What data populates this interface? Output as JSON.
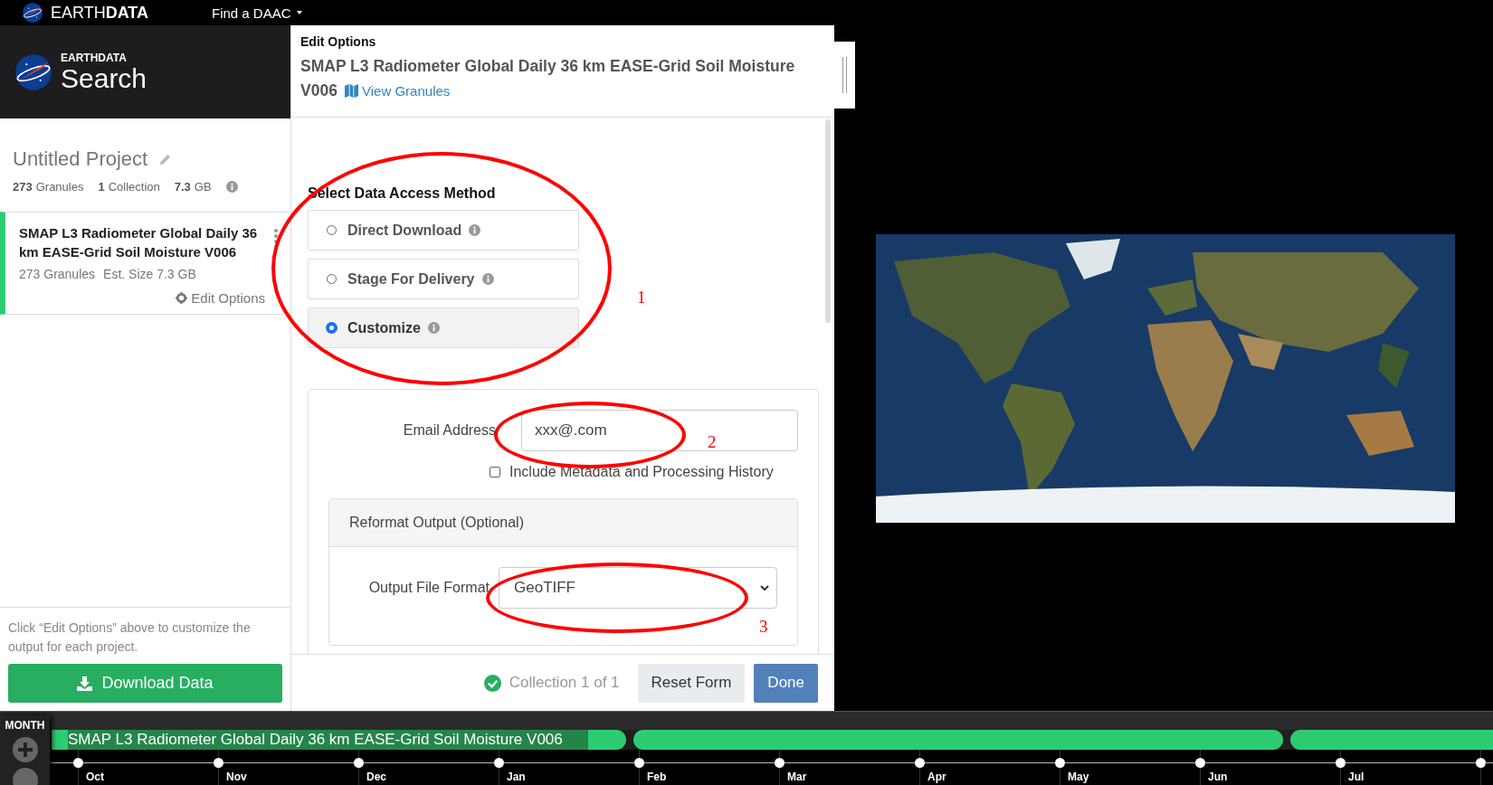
{
  "topbar": {
    "brand_light": "EARTH",
    "brand_bold": "DATA",
    "menu": "Find a DAAC"
  },
  "sidebar": {
    "kicker": "EARTHDATA",
    "title": "Search",
    "project": {
      "name": "Untitled Project",
      "stats": [
        {
          "count": "273",
          "unit": "Granules"
        },
        {
          "count": "1",
          "unit": "Collection"
        },
        {
          "count": "7.3",
          "unit": "GB"
        }
      ]
    },
    "collections": [
      {
        "title": "SMAP L3 Radiometer Global Daily 36 km EASE-Grid Soil Moisture V006",
        "granules": "273 Granules",
        "size": "Est. Size 7.3 GB",
        "action": "Edit Options",
        "selected": true
      }
    ],
    "hint": "Click “Edit Options” above to customize the output for each project.",
    "download_button": "Download Data"
  },
  "panel": {
    "heading": "Edit Options",
    "collection_title": "SMAP L3 Radiometer Global Daily 36 km EASE-Grid Soil Moisture V006",
    "link": "View Granules",
    "section_title": "Select Data Access Method",
    "methods": [
      {
        "label": "Direct Download",
        "selected": false
      },
      {
        "label": "Stage For Delivery",
        "selected": false
      },
      {
        "label": "Customize",
        "selected": true
      }
    ],
    "form": {
      "email_label": "Email Address",
      "email_value": "xxx@.com",
      "metadata": {
        "label": "Include Metadata and Processing History",
        "checked": false
      },
      "reformat": {
        "title": "Reformat Output (Optional)",
        "field_label": "Output File Format",
        "value": "GeoTIFF"
      }
    },
    "footer": {
      "status": "Collection 1 of 1",
      "reset": "Reset Form",
      "done": "Done"
    }
  },
  "timeline": {
    "zoom_label": "MONTH",
    "bar_label": "SMAP L3 Radiometer Global Daily 36 km EASE-Grid Soil Moisture V006",
    "months": [
      "Oct",
      "Nov",
      "Dec",
      "Jan",
      "Feb",
      "Mar",
      "Apr",
      "May",
      "Jun",
      "Jul"
    ]
  },
  "annotations": [
    {
      "label": "1"
    },
    {
      "label": "2"
    },
    {
      "label": "3"
    }
  ]
}
